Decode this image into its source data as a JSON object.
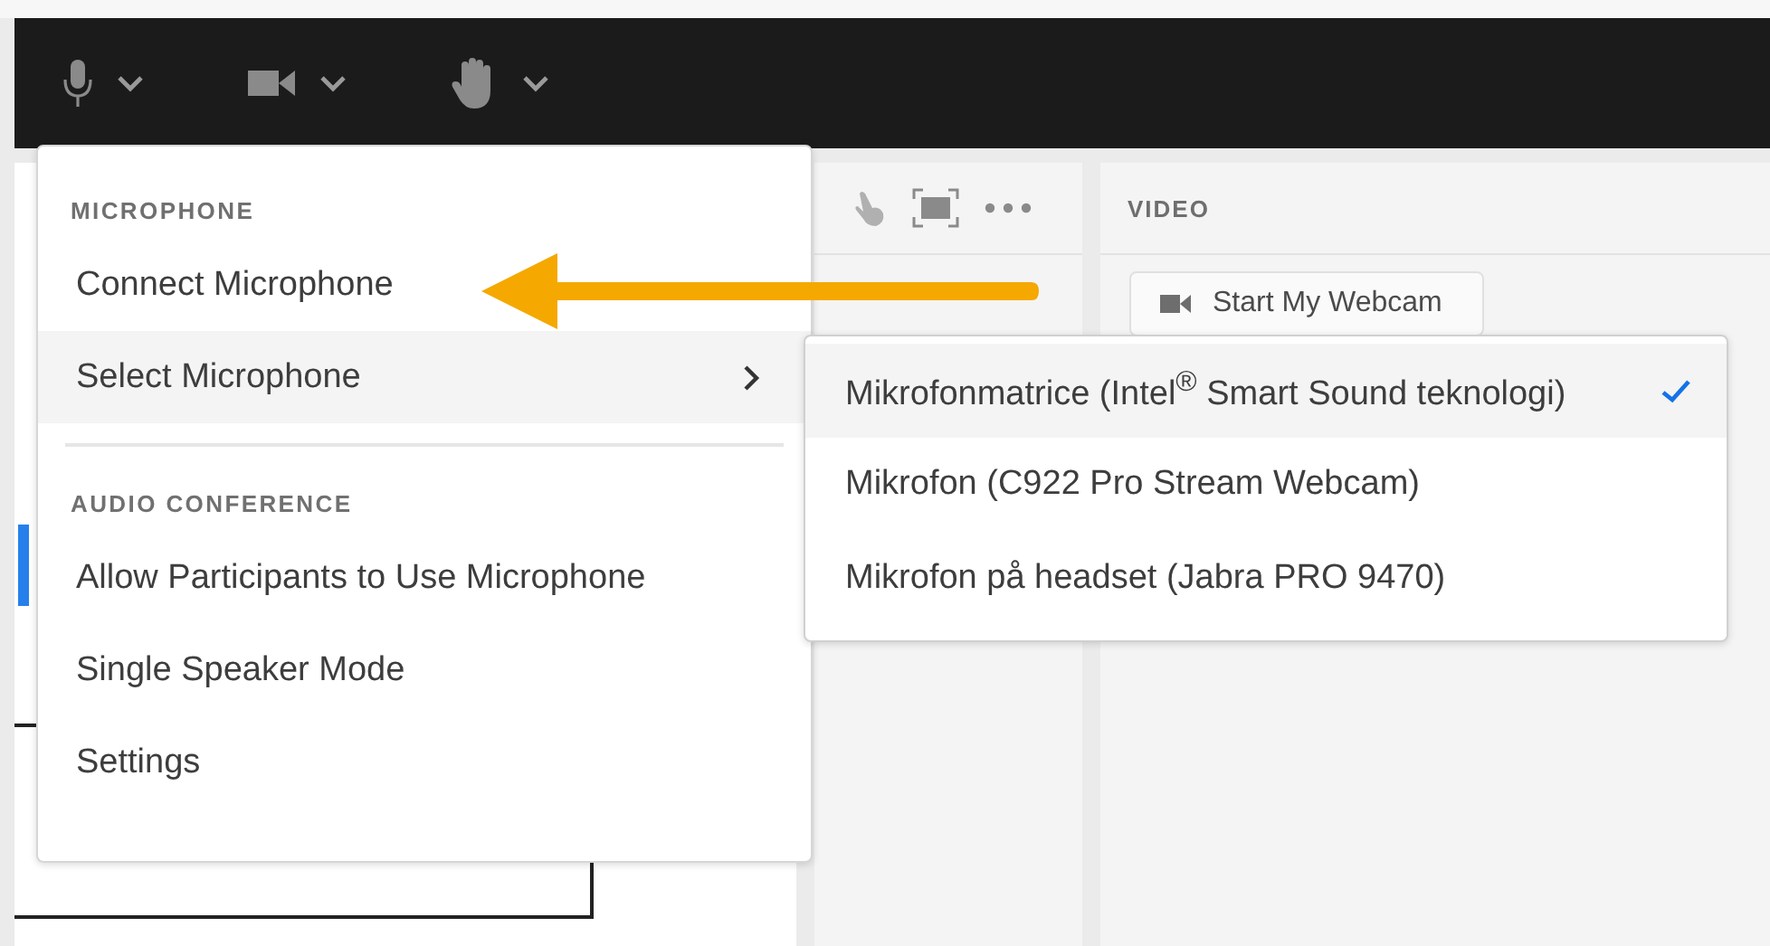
{
  "video_panel": {
    "title": "VIDEO",
    "button": "Start My Webcam"
  },
  "menu": {
    "sections": [
      {
        "heading": "MICROPHONE",
        "items": [
          {
            "label": "Connect Microphone",
            "highlighted": false,
            "has_submenu": false
          },
          {
            "label": "Select Microphone",
            "highlighted": true,
            "has_submenu": true
          }
        ]
      },
      {
        "heading": "AUDIO CONFERENCE",
        "items": [
          {
            "label": "Allow Participants to Use Microphone",
            "highlighted": false,
            "has_submenu": false
          },
          {
            "label": "Single Speaker Mode",
            "highlighted": false,
            "has_submenu": false
          },
          {
            "label": "Settings",
            "highlighted": false,
            "has_submenu": false
          }
        ]
      }
    ]
  },
  "submenu": {
    "items": [
      {
        "label": "Mikrofonmatrice (Intel$^{®}$ Smart Sound teknologi)",
        "selected": true
      },
      {
        "label": "Mikrofon (C922 Pro Stream Webcam)",
        "selected": false
      },
      {
        "label": "Mikrofon på headset (Jabra PRO 9470)",
        "selected": false
      }
    ]
  }
}
